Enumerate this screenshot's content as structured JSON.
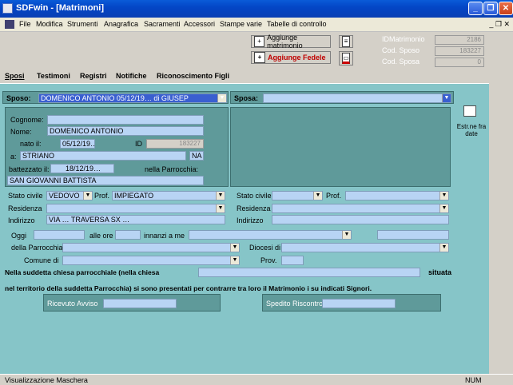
{
  "window": {
    "title": "SDFwin - [Matrimoni]",
    "btn_min": "_",
    "btn_max": "❐",
    "btn_close": "✕",
    "mdi_controls": "_ ❐ ✕"
  },
  "menu": [
    "File",
    "Modifica",
    "Strumenti",
    "Anagrafica",
    "Sacramenti",
    "Accessori",
    "Stampe varie",
    "Tabelle di controllo"
  ],
  "toolbar": {
    "add_marriage": "Aggiunge matrimonio",
    "add_faithful": "Aggiunge Fedele",
    "id_label": "IDMatrimonio",
    "id_value": "2186",
    "cod_sposo_label": "Cod. Sposo",
    "cod_sposo_value": "183227",
    "cod_sposa_label": "Cod. Sposa",
    "cod_sposa_value": "0"
  },
  "tabs": [
    "Sposi",
    "Testimoni",
    "Registri",
    "Notifiche",
    "Riconoscimento Figli"
  ],
  "sposo": {
    "label": "Sposo:",
    "select_value": "DOMENICO ANTONIO 05/12/19… di GIUSEP",
    "cognome_label": "Cognome:",
    "nome_label": "Nome:",
    "nome_value": "DOMENICO ANTONIO",
    "nato_label": "nato il:",
    "nato_value": "05/12/19…",
    "id_label": "ID",
    "id_value": "183227",
    "a_label": "a:",
    "luogo_value": "STRIANO",
    "prov_value": "NA",
    "battezzato_label": "battezzato il:",
    "battezzato_value": "18/12/19…",
    "parrocchia_label": "nella Parrocchia:",
    "parrocchia_value": "SAN GIOVANNI BATTISTA",
    "stato_label": "Stato civile",
    "stato_value": "VEDOVO",
    "prof_label": "Prof.",
    "prof_value": "IMPIEGATO",
    "residenza_label": "Residenza",
    "indirizzo_label": "Indirizzo",
    "indirizzo_value": "VIA … TRAVERSA SX …"
  },
  "sposa": {
    "label": "Sposa:",
    "stato_label": "Stato civile",
    "prof_label": "Prof.",
    "residenza_label": "Residenza",
    "indirizzo_label": "Indirizzo"
  },
  "estrai": "Estr.ne fra date",
  "form": {
    "oggi": "Oggi",
    "alle_ore": "alle ore",
    "innanzi": "innanzi a me",
    "della_parrocchia": "della Parrocchia",
    "diocesi": "Diocesi di",
    "comune": "Comune di",
    "prov": "Prov.",
    "line1": "Nella  suddetta  chiesa  parrocchiale  (nella chiesa",
    "situata": "situata",
    "line2": "nel  territorio della suddetta Parrocchia)  si sono  presentati per contrarre  tra loro il Matrimonio i su indicati Signori.",
    "ricevuto": "Ricevuto Avviso",
    "spedito": "Spedito Riscontro"
  },
  "status": {
    "text": "Visualizzazione Maschera",
    "num": "NUM"
  }
}
